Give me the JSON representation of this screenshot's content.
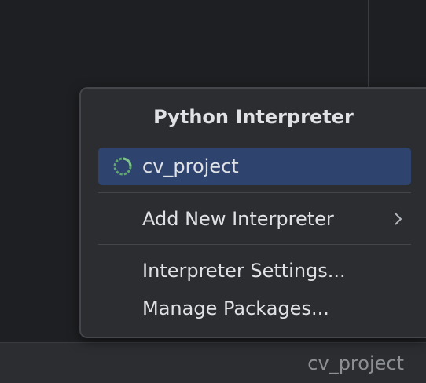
{
  "popup": {
    "title": "Python Interpreter",
    "current_interpreter": {
      "label": "cv_project",
      "icon": "loading-spinner-icon"
    },
    "add_new": {
      "label": "Add New Interpreter",
      "icon": "chevron-right-icon"
    },
    "settings_label": "Interpreter Settings...",
    "packages_label": "Manage Packages..."
  },
  "status_bar": {
    "interpreter": "cv_project"
  },
  "colors": {
    "background": "#1e1f22",
    "popup_background": "#2b2d30",
    "selection": "#2e436e",
    "spinner": "#5fa86e",
    "text": "#dfe1e5",
    "status_text": "#8c8f94"
  }
}
